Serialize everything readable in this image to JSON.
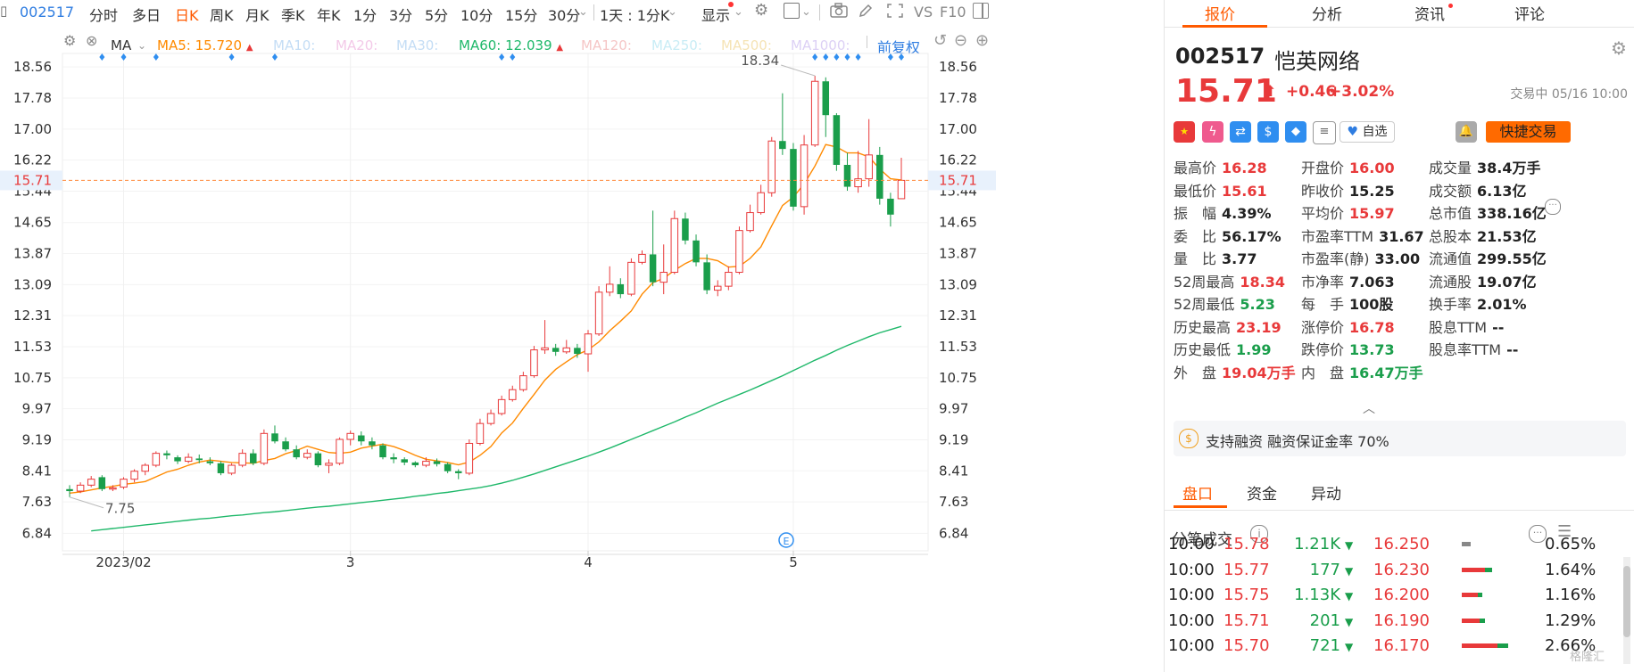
{
  "toolbar": {
    "symbol": "002517",
    "items": [
      "分时",
      "多日",
      "日K",
      "周K",
      "月K",
      "季K",
      "年K",
      "1分",
      "3分",
      "5分",
      "10分",
      "15分",
      "30分"
    ],
    "active": "日K",
    "period_select": "1天 : 1分K",
    "display": "显示",
    "vs": "VS",
    "f10": "F10"
  },
  "indicators": {
    "ma_label": "MA",
    "ma5": {
      "label": "MA5:",
      "value": "15.720",
      "color": "#ff8a00"
    },
    "ma10": {
      "label": "MA10:",
      "color": "#c4ddf5"
    },
    "ma20": {
      "label": "MA20:",
      "color": "#f3c9e8"
    },
    "ma30": {
      "label": "MA30:",
      "color": "#c4ddf5"
    },
    "ma60": {
      "label": "MA60:",
      "value": "12.039",
      "color": "#1fb86a"
    },
    "ma120": {
      "label": "MA120:",
      "color": "#f5c6c6"
    },
    "ma250": {
      "label": "MA250:",
      "color": "#c8ecf5"
    },
    "ma500": {
      "label": "MA500:",
      "color": "#f5e3b5"
    },
    "ma1000": {
      "label": "MA1000:",
      "color": "#dcd0f5"
    },
    "adjust": "前复权"
  },
  "chart_data": {
    "type": "candlestick",
    "current_price_label": "15.71",
    "ylim": [
      6.4,
      18.9
    ],
    "y_ticks": [
      "18.56",
      "17.78",
      "17.00",
      "16.22",
      "15.44",
      "14.65",
      "13.87",
      "13.09",
      "12.31",
      "11.53",
      "10.75",
      "9.97",
      "9.19",
      "8.41",
      "7.63",
      "6.84"
    ],
    "x_ticks": [
      "2023/02",
      "3",
      "4",
      "5"
    ],
    "x_tick_positions": [
      5,
      26,
      48,
      67
    ],
    "high_label": "18.34",
    "low_label": "7.75",
    "candles": [
      [
        7.95,
        7.9,
        8.05,
        7.75
      ],
      [
        7.9,
        8.05,
        8.12,
        7.85
      ],
      [
        8.05,
        8.2,
        8.28,
        8.0
      ],
      [
        8.25,
        7.95,
        8.3,
        7.9
      ],
      [
        7.95,
        7.98,
        8.05,
        7.9
      ],
      [
        8.0,
        8.2,
        8.25,
        7.95
      ],
      [
        8.2,
        8.4,
        8.45,
        8.12
      ],
      [
        8.4,
        8.55,
        8.6,
        8.3
      ],
      [
        8.55,
        8.85,
        8.9,
        8.5
      ],
      [
        8.85,
        8.8,
        8.92,
        8.7
      ],
      [
        8.75,
        8.65,
        8.8,
        8.58
      ],
      [
        8.65,
        8.75,
        8.85,
        8.6
      ],
      [
        8.72,
        8.68,
        8.82,
        8.6
      ],
      [
        8.65,
        8.6,
        8.75,
        8.55
      ],
      [
        8.6,
        8.35,
        8.65,
        8.3
      ],
      [
        8.35,
        8.55,
        8.6,
        8.3
      ],
      [
        8.55,
        8.85,
        8.95,
        8.5
      ],
      [
        8.85,
        8.6,
        8.95,
        8.55
      ],
      [
        8.6,
        9.35,
        9.45,
        8.55
      ],
      [
        9.35,
        9.15,
        9.55,
        9.1
      ],
      [
        9.15,
        8.95,
        9.25,
        8.9
      ],
      [
        8.95,
        8.75,
        9.05,
        8.7
      ],
      [
        8.75,
        8.85,
        8.95,
        8.7
      ],
      [
        8.85,
        8.55,
        8.9,
        8.5
      ],
      [
        8.55,
        8.6,
        8.7,
        8.35
      ],
      [
        8.6,
        9.2,
        9.25,
        8.55
      ],
      [
        9.2,
        9.35,
        9.42,
        9.05
      ],
      [
        9.3,
        9.15,
        9.4,
        9.05
      ],
      [
        9.15,
        9.05,
        9.25,
        8.95
      ],
      [
        9.05,
        8.75,
        9.1,
        8.7
      ],
      [
        8.75,
        8.7,
        8.85,
        8.6
      ],
      [
        8.7,
        8.62,
        8.75,
        8.55
      ],
      [
        8.62,
        8.55,
        8.65,
        8.5
      ],
      [
        8.55,
        8.65,
        8.75,
        8.5
      ],
      [
        8.65,
        8.58,
        8.72,
        8.52
      ],
      [
        8.58,
        8.4,
        8.62,
        8.35
      ],
      [
        8.4,
        8.35,
        8.45,
        8.2
      ],
      [
        8.35,
        9.1,
        9.2,
        8.3
      ],
      [
        9.1,
        9.6,
        9.72,
        9.05
      ],
      [
        9.6,
        9.85,
        9.95,
        9.55
      ],
      [
        9.85,
        10.2,
        10.3,
        9.8
      ],
      [
        10.2,
        10.45,
        10.55,
        10.15
      ],
      [
        10.45,
        10.8,
        10.9,
        10.4
      ],
      [
        10.8,
        11.45,
        11.55,
        10.75
      ],
      [
        11.45,
        11.5,
        12.2,
        11.35
      ],
      [
        11.5,
        11.4,
        11.6,
        11.3
      ],
      [
        11.4,
        11.5,
        11.7,
        11.35
      ],
      [
        11.5,
        11.35,
        11.6,
        11.25
      ],
      [
        11.35,
        11.85,
        11.95,
        10.9
      ],
      [
        11.85,
        12.9,
        13.05,
        11.8
      ],
      [
        12.9,
        13.1,
        13.55,
        12.8
      ],
      [
        13.1,
        12.85,
        13.25,
        12.75
      ],
      [
        12.85,
        13.65,
        13.75,
        12.8
      ],
      [
        13.65,
        13.85,
        13.95,
        13.6
      ],
      [
        13.85,
        13.15,
        14.95,
        13.05
      ],
      [
        13.15,
        13.4,
        14.1,
        12.85
      ],
      [
        13.4,
        14.75,
        14.95,
        13.35
      ],
      [
        14.75,
        14.2,
        14.9,
        14.1
      ],
      [
        14.2,
        13.65,
        14.35,
        13.55
      ],
      [
        13.65,
        12.95,
        13.85,
        12.85
      ],
      [
        12.95,
        13.05,
        13.2,
        12.8
      ],
      [
        13.05,
        13.4,
        13.55,
        12.95
      ],
      [
        13.4,
        14.45,
        14.55,
        13.35
      ],
      [
        14.45,
        14.9,
        15.1,
        14.4
      ],
      [
        14.9,
        15.4,
        15.6,
        14.85
      ],
      [
        15.4,
        16.7,
        16.8,
        15.3
      ],
      [
        16.7,
        16.5,
        17.9,
        16.35
      ],
      [
        16.5,
        15.05,
        16.65,
        14.95
      ],
      [
        15.05,
        16.6,
        16.85,
        14.85
      ],
      [
        16.6,
        18.2,
        18.34,
        16.55
      ],
      [
        18.2,
        17.35,
        18.3,
        16.8
      ],
      [
        17.35,
        16.1,
        17.4,
        15.95
      ],
      [
        16.1,
        15.55,
        16.4,
        15.45
      ],
      [
        15.55,
        15.75,
        16.45,
        15.4
      ],
      [
        15.75,
        16.35,
        17.25,
        15.55
      ],
      [
        16.35,
        15.25,
        16.55,
        15.1
      ],
      [
        15.25,
        14.85,
        15.4,
        14.55
      ],
      [
        15.25,
        15.71,
        16.28,
        15.61
      ]
    ],
    "ma5": [
      7.85,
      7.88,
      7.93,
      7.98,
      8.02,
      8.07,
      8.1,
      8.14,
      8.26,
      8.38,
      8.45,
      8.55,
      8.63,
      8.68,
      8.65,
      8.62,
      8.61,
      8.6,
      8.67,
      8.72,
      8.84,
      8.92,
      9.03,
      8.95,
      8.87,
      8.85,
      8.88,
      8.98,
      9.03,
      9.08,
      9.02,
      8.92,
      8.8,
      8.7,
      8.66,
      8.62,
      8.56,
      8.63,
      8.8,
      9.02,
      9.36,
      9.61,
      9.98,
      10.33,
      10.69,
      10.96,
      11.15,
      11.33,
      11.45,
      11.65,
      11.93,
      12.17,
      12.43,
      12.85,
      13.14,
      13.25,
      13.45,
      13.62,
      13.75,
      13.75,
      13.69,
      13.53,
      13.55,
      13.75,
      14.04,
      14.57,
      15.08,
      15.29,
      15.62,
      16.07,
      16.61,
      16.55,
      16.4,
      16.4,
      16.3,
      16.0,
      15.75,
      15.72
    ],
    "ma60": [
      6.9,
      6.93,
      6.96,
      6.99,
      7.02,
      7.05,
      7.08,
      7.11,
      7.14,
      7.17,
      7.2,
      7.22,
      7.25,
      7.28,
      7.3,
      7.33,
      7.36,
      7.38,
      7.41,
      7.44,
      7.47,
      7.5,
      7.52,
      7.55,
      7.58,
      7.61,
      7.64,
      7.67,
      7.7,
      7.73,
      7.77,
      7.8,
      7.84,
      7.87,
      7.91,
      7.95,
      7.99,
      8.04,
      8.1,
      8.17,
      8.25,
      8.33,
      8.42,
      8.51,
      8.6,
      8.69,
      8.78,
      8.88,
      8.98,
      9.09,
      9.2,
      9.31,
      9.42,
      9.53,
      9.64,
      9.76,
      9.87,
      9.99,
      10.11,
      10.22,
      10.33,
      10.44,
      10.56,
      10.68,
      10.8,
      10.93,
      11.06,
      11.19,
      11.31,
      11.44,
      11.56,
      11.67,
      11.78,
      11.88,
      11.96,
      12.04
    ]
  },
  "panel": {
    "tabs": [
      "报价",
      "分析",
      "资讯",
      "评论"
    ],
    "active_tab": "报价",
    "code": "002517",
    "name": "恺英网络",
    "price": "15.71",
    "change": "+0.46",
    "change_pct": "+3.02%",
    "status": "交易中 05/16 10:00",
    "watch": "自选",
    "quick_trade": "快捷交易",
    "stats_col1": [
      {
        "label": "最高价",
        "value": "16.28",
        "color": "red"
      },
      {
        "label": "最低价",
        "value": "15.61",
        "color": "red"
      },
      {
        "label": "振　幅",
        "value": "4.39%",
        "color": "black"
      },
      {
        "label": "委　比",
        "value": "56.17%",
        "color": "black"
      },
      {
        "label": "量　比",
        "value": "3.77",
        "color": "black"
      },
      {
        "label": "52周最高",
        "value": "18.34",
        "color": "red"
      },
      {
        "label": "52周最低",
        "value": "5.23",
        "color": "green"
      },
      {
        "label": "历史最高",
        "value": "23.19",
        "color": "red"
      },
      {
        "label": "历史最低",
        "value": "1.99",
        "color": "green"
      },
      {
        "label": "外　盘",
        "value": "19.04万手",
        "color": "red"
      }
    ],
    "stats_col2": [
      {
        "label": "开盘价",
        "value": "16.00",
        "color": "red"
      },
      {
        "label": "昨收价",
        "value": "15.25",
        "color": "black"
      },
      {
        "label": "平均价",
        "value": "15.97",
        "color": "red"
      },
      {
        "label": "市盈率TTM",
        "value": "31.67",
        "color": "black"
      },
      {
        "label": "市盈率(静)",
        "value": "33.00",
        "color": "black"
      },
      {
        "label": "市净率",
        "value": "7.063",
        "color": "black"
      },
      {
        "label": "每　手",
        "value": "100股",
        "color": "black"
      },
      {
        "label": "涨停价",
        "value": "16.78",
        "color": "red"
      },
      {
        "label": "跌停价",
        "value": "13.73",
        "color": "green"
      },
      {
        "label": "内　盘",
        "value": "16.47万手",
        "color": "green"
      }
    ],
    "stats_col3": [
      {
        "label": "成交量",
        "value": "38.4万手",
        "color": "black"
      },
      {
        "label": "成交额",
        "value": "6.13亿",
        "color": "black"
      },
      {
        "label": "总市值",
        "value": "338.16亿",
        "color": "black"
      },
      {
        "label": "总股本",
        "value": "21.53亿",
        "color": "black"
      },
      {
        "label": "流通值",
        "value": "299.55亿",
        "color": "black"
      },
      {
        "label": "流通股",
        "value": "19.07亿",
        "color": "black"
      },
      {
        "label": "换手率",
        "value": "2.01%",
        "color": "black"
      },
      {
        "label": "股息TTM",
        "value": "--",
        "color": "black"
      },
      {
        "label": "股息率TTM",
        "value": "--",
        "color": "black"
      }
    ],
    "margin_text": "支持融资 融资保证金率 70%",
    "sub_tabs": [
      "盘口",
      "资金",
      "异动"
    ],
    "active_sub_tab": "盘口",
    "trades_title": "分笔成交",
    "trades": [
      {
        "time": "10:00",
        "price": "15.78",
        "vol": "1.21K",
        "level": "16.250",
        "pct": "0.65%"
      },
      {
        "time": "10:00",
        "price": "15.77",
        "vol": "177",
        "level": "16.230",
        "pct": "1.64%"
      },
      {
        "time": "10:00",
        "price": "15.75",
        "vol": "1.13K",
        "level": "16.200",
        "pct": "1.16%"
      },
      {
        "time": "10:00",
        "price": "15.71",
        "vol": "201",
        "level": "16.190",
        "pct": "1.29%"
      },
      {
        "time": "10:00",
        "price": "15.70",
        "vol": "721",
        "level": "16.170",
        "pct": "2.66%"
      }
    ],
    "watermark": "格隆汇"
  }
}
